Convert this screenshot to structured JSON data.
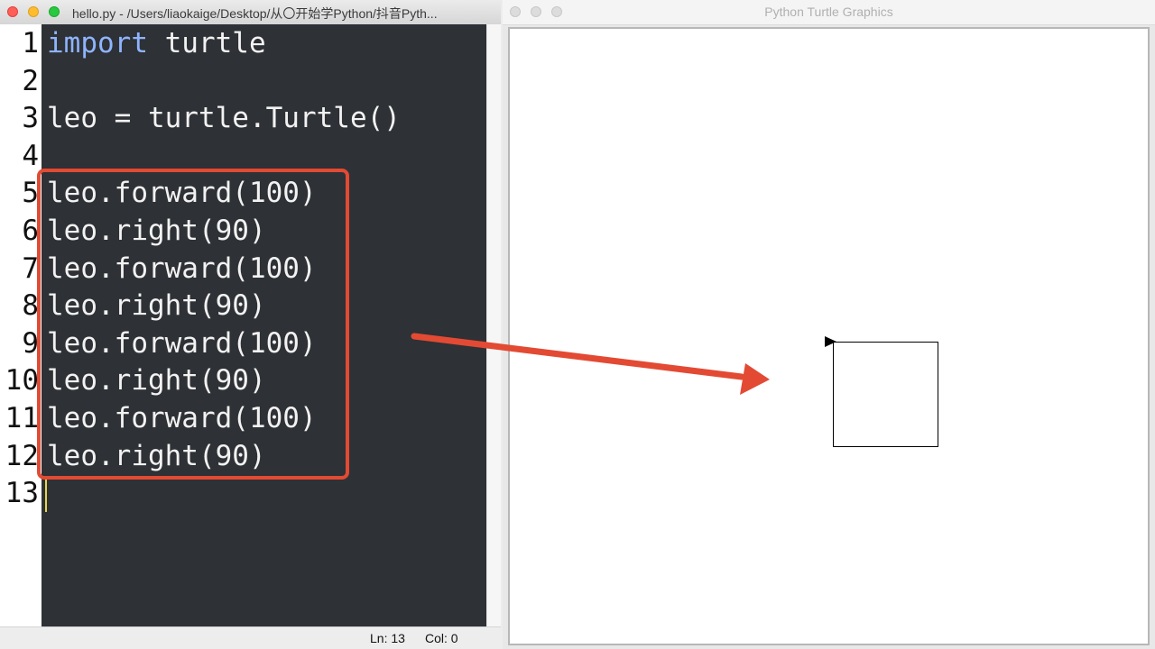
{
  "editor": {
    "title": "hello.py - /Users/liaokaige/Desktop/从〇开始学Python/抖音Pyth...",
    "lines": [
      {
        "num": "1",
        "kw": "import",
        "rest": " turtle"
      },
      {
        "num": "2",
        "kw": "",
        "rest": ""
      },
      {
        "num": "3",
        "kw": "",
        "rest": "leo = turtle.Turtle()"
      },
      {
        "num": "4",
        "kw": "",
        "rest": ""
      },
      {
        "num": "5",
        "kw": "",
        "rest": "leo.forward(100)"
      },
      {
        "num": "6",
        "kw": "",
        "rest": "leo.right(90)"
      },
      {
        "num": "7",
        "kw": "",
        "rest": "leo.forward(100)"
      },
      {
        "num": "8",
        "kw": "",
        "rest": "leo.right(90)"
      },
      {
        "num": "9",
        "kw": "",
        "rest": "leo.forward(100)"
      },
      {
        "num": "10",
        "kw": "",
        "rest": "leo.right(90)"
      },
      {
        "num": "11",
        "kw": "",
        "rest": "leo.forward(100)"
      },
      {
        "num": "12",
        "kw": "",
        "rest": "leo.right(90)"
      },
      {
        "num": "13",
        "kw": "",
        "rest": ""
      }
    ],
    "status": {
      "ln": "Ln: 13",
      "col": "Col: 0"
    }
  },
  "turtle_window": {
    "title": "Python Turtle Graphics"
  },
  "colors": {
    "annotation": "#e34a33",
    "editor_bg": "#2e3135",
    "keyword": "#8fb4ff"
  }
}
